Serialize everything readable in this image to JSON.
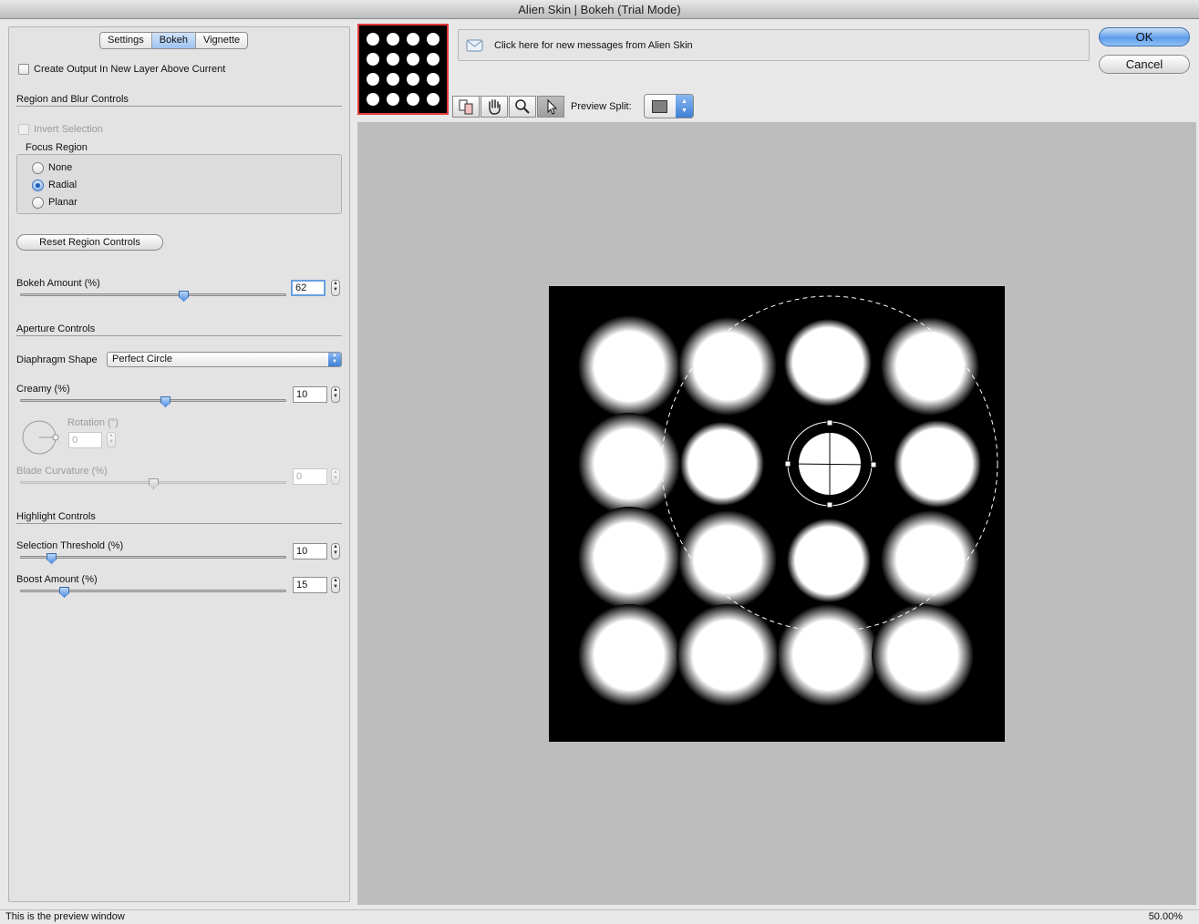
{
  "window": {
    "title": "Alien Skin | Bokeh (Trial Mode)"
  },
  "tabs": [
    {
      "label": "Settings",
      "active": false
    },
    {
      "label": "Bokeh",
      "active": true
    },
    {
      "label": "Vignette",
      "active": false
    }
  ],
  "panel": {
    "create_output_label": "Create Output In New Layer Above Current",
    "create_output_checked": false,
    "region_section": "Region and Blur Controls",
    "invert_selection_label": "Invert Selection",
    "focus_region_label": "Focus Region",
    "focus_options": [
      {
        "label": "None",
        "selected": false
      },
      {
        "label": "Radial",
        "selected": true
      },
      {
        "label": "Planar",
        "selected": false
      }
    ],
    "reset_button": "Reset Region Controls",
    "bokeh_amount": {
      "label": "Bokeh Amount (%)",
      "value": "62",
      "fraction": 0.62
    },
    "aperture_section": "Aperture Controls",
    "diaphragm_label": "Diaphragm Shape",
    "diaphragm_value": "Perfect Circle",
    "creamy": {
      "label": "Creamy (%)",
      "value": "10",
      "fraction": 0.55
    },
    "rotation": {
      "label": "Rotation (°)",
      "value": "0"
    },
    "blade_curvature": {
      "label": "Blade Curvature (%)",
      "value": "0",
      "fraction": 0.5
    },
    "highlight_section": "Highlight Controls",
    "selection_threshold": {
      "label": "Selection Threshold (%)",
      "value": "10",
      "fraction": 0.1
    },
    "boost_amount": {
      "label": "Boost Amount (%)",
      "value": "15",
      "fraction": 0.15
    }
  },
  "messages": {
    "text": "Click here for new messages from Alien Skin"
  },
  "buttons": {
    "ok": "OK",
    "cancel": "Cancel"
  },
  "toolbar": {
    "preview_split_label": "Preview Split:"
  },
  "status": {
    "text": "This is the preview window",
    "zoom": "50.00%"
  },
  "colors": {
    "accent": "#5e9cea",
    "thumb_border": "#e23b3b",
    "preview_bg": "#bdbdbd"
  }
}
